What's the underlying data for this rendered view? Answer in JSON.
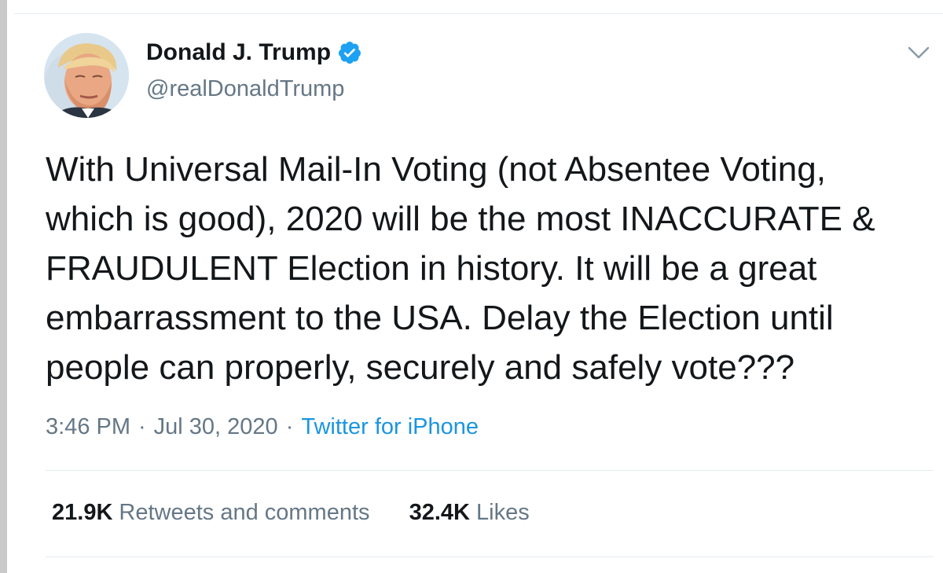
{
  "author": {
    "display_name": "Donald J. Trump",
    "handle": "@realDonaldTrump",
    "verified_icon": "verified-badge-icon",
    "avatar": "profile-photo"
  },
  "menu": {
    "icon": "chevron-down-icon"
  },
  "tweet": {
    "text": "With Universal Mail-In Voting (not Absentee Voting,\nwhich is good), 2020 will be the most INACCURATE &\nFRAUDULENT Election in history. It will be a great\nembarrassment to the USA. Delay the Election until\npeople can properly, securely and safely vote???"
  },
  "meta": {
    "time": "3:46 PM",
    "separator": "·",
    "date": "Jul 30, 2020",
    "source": "Twitter for iPhone"
  },
  "stats": {
    "retweets_count": "21.9K",
    "retweets_label": "Retweets and comments",
    "likes_count": "32.4K",
    "likes_label": "Likes"
  },
  "colors": {
    "text": "#14171a",
    "secondary": "#657786",
    "accent": "#1b95e0",
    "verified": "#1da1f2",
    "divider": "#e6ecf0"
  }
}
